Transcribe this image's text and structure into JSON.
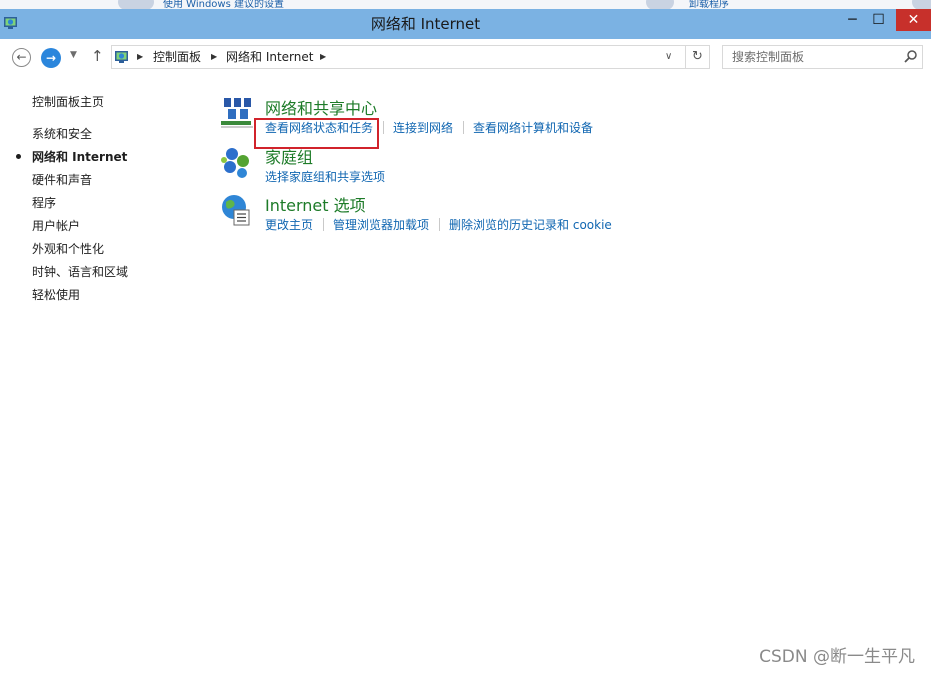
{
  "background": {
    "partial_text_1": "使用 Windows 建议的设置",
    "partial_text_2": "卸载程序"
  },
  "window": {
    "title": "网络和 Internet",
    "icon": "network-globe-icon",
    "controls": {
      "minimize": "─",
      "maximize": "☐",
      "close": "✕"
    }
  },
  "address": {
    "breadcrumbs": [
      "控制面板",
      "网络和 Internet"
    ],
    "search_placeholder": "搜索控制面板"
  },
  "sidebar": {
    "home": "控制面板主页",
    "items": [
      {
        "label": "系统和安全",
        "current": false
      },
      {
        "label": "网络和 Internet",
        "current": true
      },
      {
        "label": "硬件和声音",
        "current": false
      },
      {
        "label": "程序",
        "current": false
      },
      {
        "label": "用户帐户",
        "current": false
      },
      {
        "label": "外观和个性化",
        "current": false
      },
      {
        "label": "时钟、语言和区域",
        "current": false
      },
      {
        "label": "轻松使用",
        "current": false
      }
    ]
  },
  "categories": [
    {
      "title": "网络和共享中心",
      "icon": "network-sharing-center-icon",
      "links": [
        "查看网络状态和任务",
        "连接到网络",
        "查看网络计算机和设备"
      ]
    },
    {
      "title": "家庭组",
      "icon": "homegroup-icon",
      "links": [
        "选择家庭组和共享选项"
      ]
    },
    {
      "title": "Internet 选项",
      "icon": "internet-options-icon",
      "links": [
        "更改主页",
        "管理浏览器加载项",
        "删除浏览的历史记录和 cookie"
      ]
    }
  ],
  "colors": {
    "titlebar": "#7bb2e3",
    "close_button": "#c7302b",
    "category_title": "#1d7b28",
    "link": "#1066b1",
    "highlight_box": "#d1232b"
  },
  "watermark": "CSDN @断一生平凡"
}
